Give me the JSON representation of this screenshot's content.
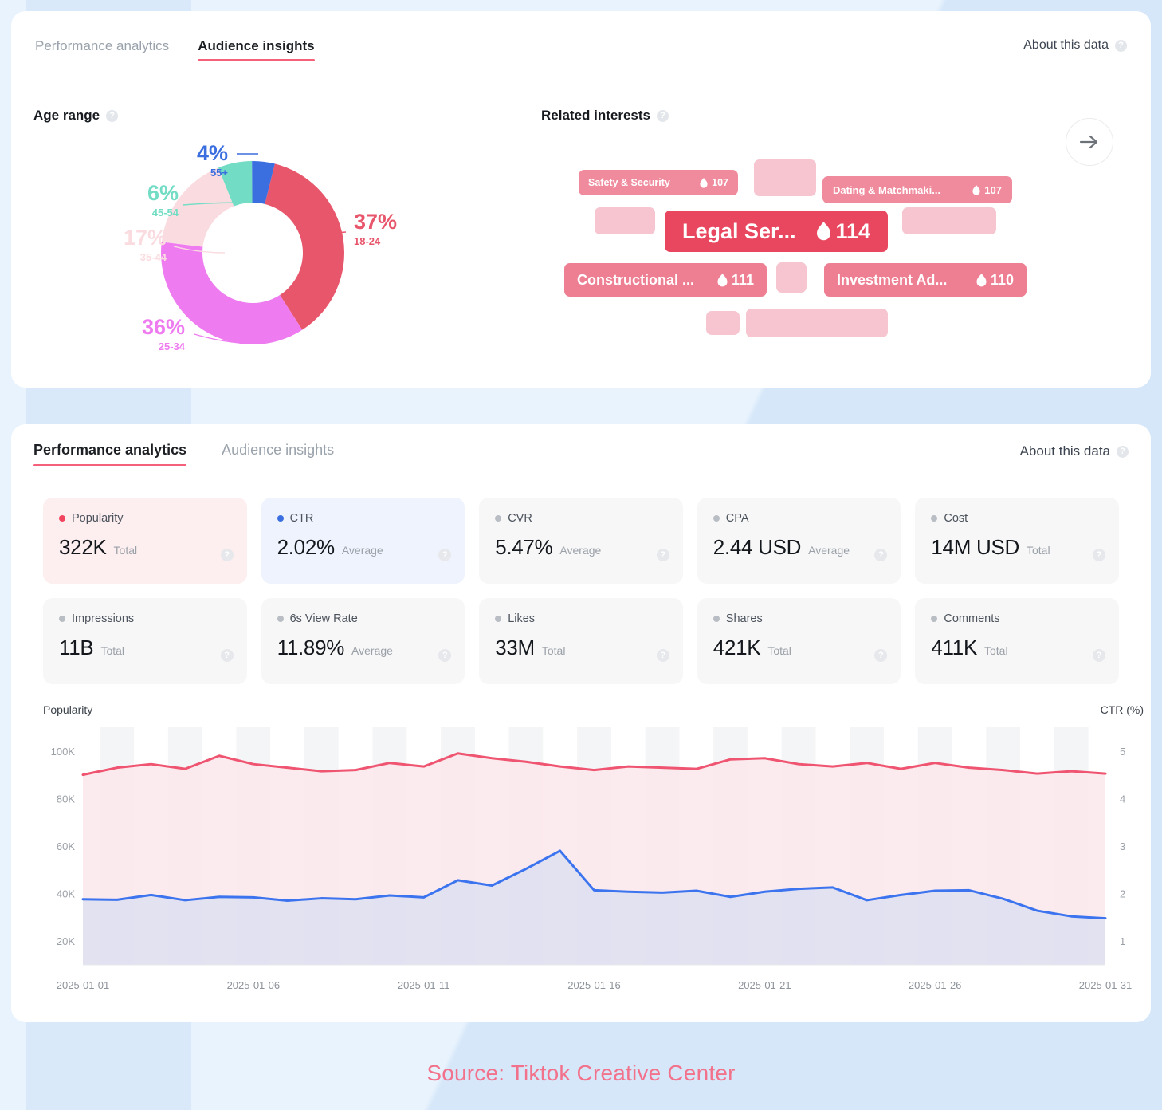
{
  "audience_panel": {
    "tabs": [
      {
        "label": "Performance analytics",
        "active": false
      },
      {
        "label": "Audience insights",
        "active": true
      }
    ],
    "about_label": "About this data",
    "age_range_title": "Age range",
    "related_interests_title": "Related interests",
    "next_icon": "arrow-right-icon"
  },
  "age_chart": {
    "type": "pie",
    "title": "Age range",
    "categories": [
      "18-24",
      "25-34",
      "35-44",
      "45-54",
      "55+"
    ],
    "values": [
      37,
      36,
      17,
      6,
      4
    ],
    "labels": [
      "37%",
      "36%",
      "17%",
      "6%",
      "4%"
    ],
    "colors": [
      "#e8566c",
      "#ee7cf0",
      "#fadce0",
      "#72ddc4",
      "#3b6fe0"
    ],
    "unit": "%"
  },
  "related_interests": [
    {
      "label": "Safety & Security",
      "score": "107",
      "size": "small"
    },
    {
      "label": "Dating & Matchmaki...",
      "score": "107",
      "size": "small"
    },
    {
      "label": "Legal Ser...",
      "score": "114",
      "size": "large"
    },
    {
      "label": "Constructional ...",
      "score": "111",
      "size": "medium"
    },
    {
      "label": "Investment Ad...",
      "score": "110",
      "size": "medium"
    }
  ],
  "performance_panel": {
    "tabs": [
      {
        "label": "Performance analytics",
        "active": true
      },
      {
        "label": "Audience insights",
        "active": false
      }
    ],
    "about_label": "About this data"
  },
  "kpis": [
    {
      "name": "Popularity",
      "value": "322K",
      "unit": "Total",
      "dot": "#f2455f",
      "style": "accent-red"
    },
    {
      "name": "CTR",
      "value": "2.02%",
      "unit": "Average",
      "dot": "#3b6fe0",
      "style": "accent-blue"
    },
    {
      "name": "CVR",
      "value": "5.47%",
      "unit": "Average",
      "dot": "#b9bec4",
      "style": ""
    },
    {
      "name": "CPA",
      "value": "2.44 USD",
      "unit": "Average",
      "dot": "#b9bec4",
      "style": ""
    },
    {
      "name": "Cost",
      "value": "14M USD",
      "unit": "Total",
      "dot": "#b9bec4",
      "style": ""
    },
    {
      "name": "Impressions",
      "value": "11B",
      "unit": "Total",
      "dot": "#b9bec4",
      "style": ""
    },
    {
      "name": "6s View Rate",
      "value": "11.89%",
      "unit": "Average",
      "dot": "#b9bec4",
      "style": ""
    },
    {
      "name": "Likes",
      "value": "33M",
      "unit": "Total",
      "dot": "#b9bec4",
      "style": ""
    },
    {
      "name": "Shares",
      "value": "421K",
      "unit": "Total",
      "dot": "#b9bec4",
      "style": ""
    },
    {
      "name": "Comments",
      "value": "411K",
      "unit": "Total",
      "dot": "#b9bec4",
      "style": ""
    }
  ],
  "chart_data": {
    "type": "line",
    "title": "",
    "xlabel": "",
    "ylabel": "Popularity",
    "y2label": "CTR (%)",
    "ylim": [
      10000,
      110000
    ],
    "y2lim": [
      0.5,
      5.5
    ],
    "yticks": [
      "20K",
      "40K",
      "60K",
      "80K",
      "100K"
    ],
    "ytick_values": [
      20000,
      40000,
      60000,
      80000,
      100000
    ],
    "y2ticks": [
      "1",
      "2",
      "3",
      "4",
      "5"
    ],
    "y2tick_values": [
      1,
      2,
      3,
      4,
      5
    ],
    "grid": false,
    "legend": "none",
    "x": [
      "2025-01-01",
      "2025-01-02",
      "2025-01-03",
      "2025-01-04",
      "2025-01-05",
      "2025-01-06",
      "2025-01-07",
      "2025-01-08",
      "2025-01-09",
      "2025-01-10",
      "2025-01-11",
      "2025-01-12",
      "2025-01-13",
      "2025-01-14",
      "2025-01-15",
      "2025-01-16",
      "2025-01-17",
      "2025-01-18",
      "2025-01-19",
      "2025-01-20",
      "2025-01-21",
      "2025-01-22",
      "2025-01-23",
      "2025-01-24",
      "2025-01-25",
      "2025-01-26",
      "2025-01-27",
      "2025-01-28",
      "2025-01-29",
      "2025-01-30",
      "2025-01-31"
    ],
    "xtick_labels": [
      "2025-01-01",
      "2025-01-06",
      "2025-01-11",
      "2025-01-16",
      "2025-01-21",
      "2025-01-26",
      "2025-01-31"
    ],
    "xtick_indices": [
      0,
      5,
      10,
      15,
      20,
      25,
      30
    ],
    "series": [
      {
        "name": "Popularity",
        "axis": "left",
        "color": "#ef5470",
        "fill": "#fbe7ea",
        "values": [
          90000,
          93000,
          94500,
          92500,
          98000,
          94500,
          93000,
          91500,
          92000,
          95000,
          93500,
          99000,
          97000,
          95500,
          93500,
          92000,
          93500,
          93000,
          92500,
          96500,
          97000,
          94500,
          93500,
          95000,
          92500,
          95000,
          93000,
          92000,
          90500,
          91500,
          90500
        ]
      },
      {
        "name": "CTR",
        "axis": "right",
        "color": "#3c74ef",
        "fill": "#dcdff2",
        "values": [
          1.88,
          1.87,
          1.97,
          1.86,
          1.93,
          1.92,
          1.85,
          1.9,
          1.88,
          1.96,
          1.92,
          2.28,
          2.17,
          2.52,
          2.9,
          2.07,
          2.04,
          2.02,
          2.06,
          1.93,
          2.04,
          2.1,
          2.13,
          1.86,
          1.97,
          2.06,
          2.07,
          1.89,
          1.64,
          1.52,
          1.48
        ]
      }
    ]
  },
  "footer": {
    "source": "Source: Tiktok Creative Center",
    "source_color": "#f2728c"
  }
}
